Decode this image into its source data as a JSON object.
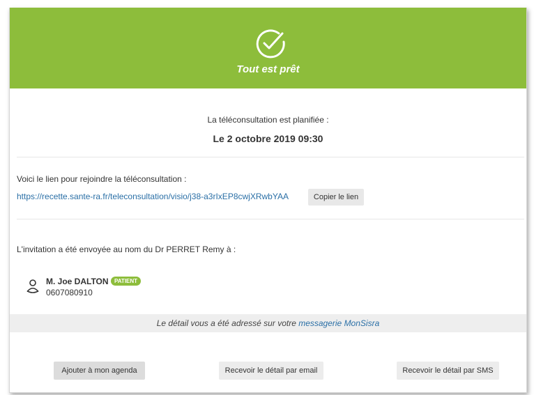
{
  "header": {
    "title": "Tout est prêt",
    "color": "#8dbd3b"
  },
  "schedule": {
    "label": "La téléconsultation est planifiée :",
    "date": "Le 2 octobre 2019 09:30"
  },
  "link_section": {
    "label": "Voici le lien pour rejoindre la téléconsultation :",
    "url": "https://recette.sante-ra.fr/teleconsultation/visio/j38-a3rIxEP8cwjXRwbYAA",
    "copy_label": "Copier le lien",
    "link_color": "#2a6fa6"
  },
  "invitation": {
    "label": "L'invitation a été envoyée au nom du Dr PERRET Remy à :",
    "person": {
      "name": "M. Joe DALTON",
      "badge": "PATIENT",
      "phone": "0607080910",
      "icon": "person-icon"
    }
  },
  "info_bar": {
    "text": "Le détail vous a été adressé sur votre ",
    "link": "messagerie MonSisra"
  },
  "actions": {
    "agenda": "Ajouter à mon agenda",
    "email": "Recevoir le détail par email",
    "sms": "Recevoir le détail par SMS"
  }
}
